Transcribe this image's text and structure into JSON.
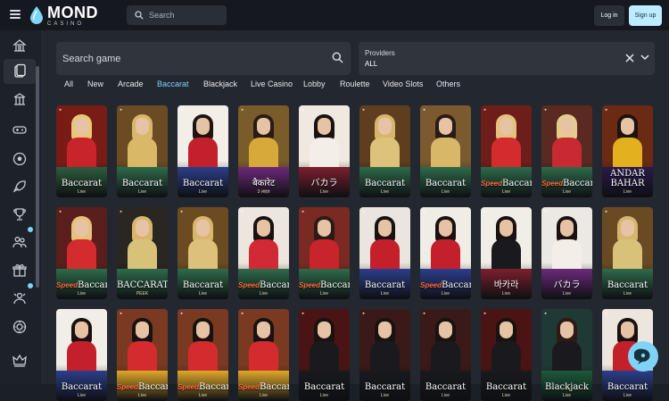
{
  "header": {
    "logo_main": "MOND",
    "logo_sub": "CASINO",
    "search_placeholder": "Search",
    "login_label": "Log in",
    "signup_label": "Sign up"
  },
  "sidebar": {
    "items": [
      {
        "icon": "casino-building-icon",
        "active": false,
        "dot": false
      },
      {
        "icon": "cards-icon",
        "active": true,
        "dot": false
      },
      {
        "icon": "live-casino-icon",
        "active": false,
        "dot": false
      },
      {
        "icon": "esports-icon",
        "active": false,
        "dot": false
      },
      {
        "icon": "football-icon",
        "active": false,
        "dot": false
      },
      {
        "icon": "rocket-icon",
        "active": false,
        "dot": false
      },
      {
        "icon": "trophy-icon",
        "active": false,
        "dot": false
      },
      {
        "icon": "users-icon",
        "active": false,
        "dot": true
      },
      {
        "icon": "gift-icon",
        "active": false,
        "dot": false
      },
      {
        "icon": "vip-icon",
        "active": false,
        "dot": true
      },
      {
        "icon": "chip-icon",
        "active": false,
        "dot": false
      },
      {
        "icon": "crown-icon",
        "active": false,
        "dot": false
      }
    ]
  },
  "search": {
    "placeholder": "Search game"
  },
  "providers": {
    "label": "Providers",
    "value": "ALL"
  },
  "tabs": [
    {
      "label": "All",
      "active": false
    },
    {
      "label": "New",
      "active": false
    },
    {
      "label": "Arcade",
      "active": false
    },
    {
      "label": "Baccarat",
      "active": true
    },
    {
      "label": "Blackjack",
      "active": false
    },
    {
      "label": "Live Casino",
      "active": false
    },
    {
      "label": "Lobby",
      "active": false
    },
    {
      "label": "Roulette",
      "active": false
    },
    {
      "label": "Video Slots",
      "active": false
    },
    {
      "label": "Others",
      "active": false
    }
  ],
  "games": [
    {
      "title": "Baccarat",
      "sub": "Live",
      "prefix": "",
      "bg": "#7a1c16",
      "table": "#2e5d3f",
      "hair": "#e8c877",
      "body": "#c8242b"
    },
    {
      "title": "Baccarat",
      "sub": "Live",
      "prefix": "",
      "bg": "#6b4b24",
      "table": "#2f6a4a",
      "hair": "#d9b66c",
      "body": "#d9b868"
    },
    {
      "title": "Baccarat",
      "sub": "Live",
      "prefix": "",
      "bg": "#f2efe9",
      "table": "#2c3e8a",
      "hair": "#1e1412",
      "body": "#c3202c"
    },
    {
      "title": "बैकारेट",
      "sub": "3 लाइव",
      "prefix": "",
      "bg": "#7a5b2a",
      "table": "#6c2a7a",
      "hair": "#2a1b14",
      "body": "#d7a83a"
    },
    {
      "title": "バカラ",
      "sub": "Live",
      "prefix": "",
      "bg": "#efe9df",
      "table": "#7c1f2e",
      "hair": "#1a1210",
      "body": "#f3efe8"
    },
    {
      "title": "Baccarat",
      "sub": "Live",
      "prefix": "",
      "bg": "#5e3e1e",
      "table": "#2f6a4a",
      "hair": "#d6b56c",
      "body": "#dcc27a"
    },
    {
      "title": "Baccarat",
      "sub": "Live",
      "prefix": "",
      "bg": "#7a5a2e",
      "table": "#2f6a4a",
      "hair": "#2a1b14",
      "body": "#d8b769"
    },
    {
      "title": "Baccarat",
      "sub": "Live",
      "prefix": "Speed",
      "bg": "#6e1e1a",
      "table": "#2f6a4a",
      "hair": "#e3c27a",
      "body": "#d42b2e"
    },
    {
      "title": "Baccarat",
      "sub": "Live",
      "prefix": "Speed",
      "bg": "#5a2a22",
      "table": "#2f6a4a",
      "hair": "#e6cc8c",
      "body": "#c92a32"
    },
    {
      "title": "ANDAR BAHAR",
      "sub": "Live",
      "prefix": "",
      "bg": "#6b2a14",
      "table": "#2a1a4a",
      "hair": "#1c1210",
      "body": "#e3b020"
    },
    {
      "title": "Baccarat",
      "sub": "Live",
      "prefix": "Speed",
      "bg": "#5a1f1c",
      "table": "#2f6a4a",
      "hair": "#e3c27a",
      "body": "#d42b2e"
    },
    {
      "title": "BACCARAT",
      "sub": "PEEK",
      "prefix": "",
      "bg": "#2a2622",
      "table": "#2f6a4a",
      "hair": "#d9b56c",
      "body": "#d8c27a"
    },
    {
      "title": "Baccarat",
      "sub": "Live",
      "prefix": "",
      "bg": "#6a4b22",
      "table": "#2f6a4a",
      "hair": "#d9b66c",
      "body": "#ddc07a"
    },
    {
      "title": "Baccarat",
      "sub": "Live",
      "prefix": "Speed",
      "bg": "#ece6de",
      "table": "#2f6a4a",
      "hair": "#1a1210",
      "body": "#d12a34"
    },
    {
      "title": "Baccarat",
      "sub": "Live",
      "prefix": "Speed",
      "bg": "#7a2a22",
      "table": "#2f6a4a",
      "hair": "#2a1b14",
      "body": "#c8242b"
    },
    {
      "title": "Baccarat",
      "sub": "Live",
      "prefix": "",
      "bg": "#eae6df",
      "table": "#2c3e8a",
      "hair": "#1a1210",
      "body": "#c3202c"
    },
    {
      "title": "Baccarat",
      "sub": "Live",
      "prefix": "Speed",
      "bg": "#f0ece6",
      "table": "#2c3e8a",
      "hair": "#1a1210",
      "body": "#c3202c"
    },
    {
      "title": "바카라",
      "sub": "Live",
      "prefix": "",
      "bg": "#f1eee8",
      "table": "#7c1f2e",
      "hair": "#1a1210",
      "body": "#1a1a1e"
    },
    {
      "title": "バカラ",
      "sub": "Live",
      "prefix": "",
      "bg": "#ece9e4",
      "table": "#6c2a7a",
      "hair": "#1a1210",
      "body": "#f3efe8"
    },
    {
      "title": "Baccarat",
      "sub": "Live",
      "prefix": "",
      "bg": "#6a4a22",
      "table": "#2f6a4a",
      "hair": "#d6b56c",
      "body": "#d8c27a"
    },
    {
      "title": "Baccarat",
      "sub": "Live",
      "prefix": "",
      "bg": "#f1eee8",
      "table": "#2c3e8a",
      "hair": "#1a1210",
      "body": "#c3202c"
    },
    {
      "title": "Baccarat",
      "sub": "Live",
      "prefix": "Speed",
      "bg": "#7a3a22",
      "table": "#e0a82a",
      "hair": "#1a1210",
      "body": "#d42b2e"
    },
    {
      "title": "Baccarat",
      "sub": "Live",
      "prefix": "Speed",
      "bg": "#7a3a22",
      "table": "#e0a82a",
      "hair": "#1a1210",
      "body": "#d42b2e"
    },
    {
      "title": "Baccarat",
      "sub": "Live",
      "prefix": "Speed",
      "bg": "#7a3a22",
      "table": "#e0a82a",
      "hair": "#1a1210",
      "body": "#d42b2e"
    },
    {
      "title": "Baccarat",
      "sub": "Live",
      "prefix": "",
      "bg": "#4a1414",
      "table": "#1a1a1e",
      "hair": "#1a1210",
      "body": "#1a1a1e"
    },
    {
      "title": "Baccarat",
      "sub": "Live",
      "prefix": "",
      "bg": "#3a1a18",
      "table": "#1a1a1e",
      "hair": "#1a1210",
      "body": "#1a1a1e"
    },
    {
      "title": "Baccarat",
      "sub": "Live",
      "prefix": "",
      "bg": "#3a1a18",
      "table": "#1a1a1e",
      "hair": "#1a1210",
      "body": "#1a1a1e"
    },
    {
      "title": "Baccarat",
      "sub": "Live",
      "prefix": "",
      "bg": "#4a1414",
      "table": "#1a1a1e",
      "hair": "#1a1210",
      "body": "#1a1a1e"
    },
    {
      "title": "Blackjack",
      "sub": "Live",
      "prefix": "",
      "bg": "#1f3a34",
      "table": "#1e5a3a",
      "hair": "#2a1b14",
      "body": "#1a1a1e"
    },
    {
      "title": "Baccarat",
      "sub": "Live",
      "prefix": "",
      "bg": "#ece6de",
      "table": "#2c3e8a",
      "hair": "#1a1210",
      "body": "#c3202c"
    }
  ],
  "colors": {
    "accent": "#7fd3f5",
    "topbar": "#15181e",
    "sidebar": "#1d2129",
    "main": "#23272f",
    "input": "#30343d"
  },
  "chat_icon": "chat-bubble-icon"
}
